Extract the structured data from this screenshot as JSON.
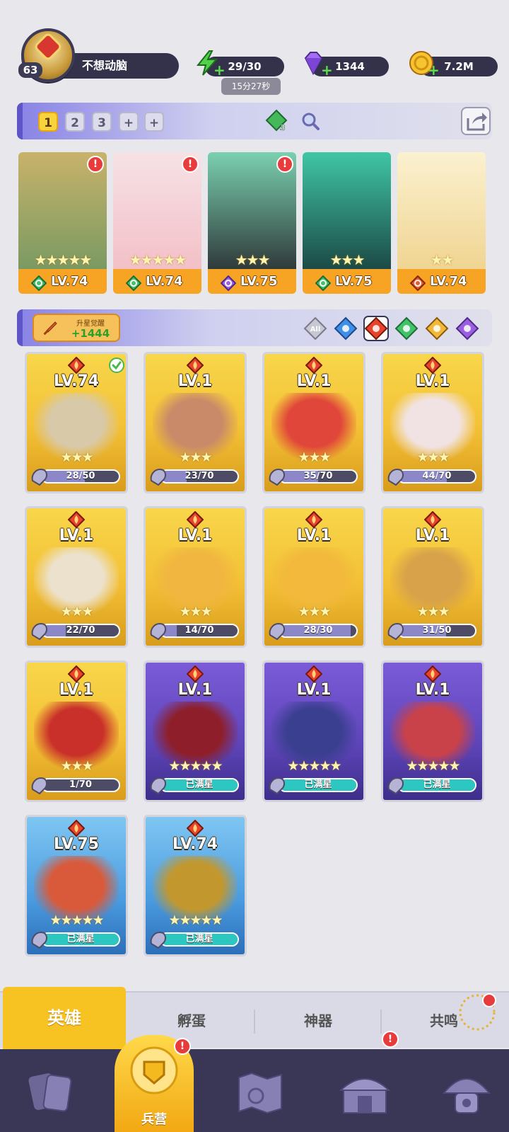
{
  "player": {
    "level": "63",
    "name": "不想动脑"
  },
  "resources": {
    "energy": {
      "value": "29/30",
      "icon": "lightning-icon",
      "timer": "15分27秒"
    },
    "gems": {
      "value": "1344",
      "icon": "diamond-icon"
    },
    "gold": {
      "value": "7.2M",
      "icon": "coin-icon"
    }
  },
  "team_tabs": [
    "1",
    "2",
    "3",
    "+",
    "+"
  ],
  "gem_count": "3",
  "team": [
    {
      "level": "LV.74",
      "stars": "★★★★★",
      "element": "wind",
      "alert": "!",
      "colors": [
        "#7a9a62",
        "#c8b26a"
      ]
    },
    {
      "level": "LV.74",
      "stars": "★★★★★",
      "element": "wind",
      "alert": "!",
      "colors": [
        "#f3c0c7",
        "#f6e2e6"
      ]
    },
    {
      "level": "LV.75",
      "stars": "★★★",
      "element": "dark",
      "alert": "!",
      "colors": [
        "#2f3a3a",
        "#7ad0b0"
      ]
    },
    {
      "level": "LV.75",
      "stars": "★★★",
      "element": "wind",
      "alert": "",
      "colors": [
        "#1c4a46",
        "#3fc6a4"
      ]
    },
    {
      "level": "LV.74",
      "stars": "★★",
      "element": "fire",
      "alert": "",
      "colors": [
        "#f0d592",
        "#fbf1d0"
      ]
    }
  ],
  "awaken": {
    "label": "升星觉醒",
    "value": "+1444"
  },
  "filters": [
    "All",
    "water",
    "fire",
    "wind",
    "light",
    "dark"
  ],
  "roster": [
    {
      "level": "LV.74",
      "stars": "★★★",
      "progress": "28/50",
      "ratio": 0.56,
      "tier": "gold",
      "checked": true,
      "art": "#d8c9a8"
    },
    {
      "level": "LV.1",
      "stars": "★★★",
      "progress": "23/70",
      "ratio": 0.33,
      "tier": "gold",
      "checked": false,
      "art": "#c98a6a"
    },
    {
      "level": "LV.1",
      "stars": "★★★",
      "progress": "35/70",
      "ratio": 0.5,
      "tier": "gold",
      "checked": false,
      "art": "#e0463a"
    },
    {
      "level": "LV.1",
      "stars": "★★★",
      "progress": "44/70",
      "ratio": 0.63,
      "tier": "gold",
      "checked": false,
      "art": "#f1e3e3"
    },
    {
      "level": "LV.1",
      "stars": "★★★",
      "progress": "22/70",
      "ratio": 0.31,
      "tier": "gold",
      "checked": false,
      "art": "#ece1cc"
    },
    {
      "level": "LV.1",
      "stars": "★★★",
      "progress": "14/70",
      "ratio": 0.2,
      "tier": "gold",
      "checked": false,
      "art": "#f0b640"
    },
    {
      "level": "LV.1",
      "stars": "★★★",
      "progress": "28/30",
      "ratio": 0.93,
      "tier": "gold",
      "checked": false,
      "art": "#f2b93c"
    },
    {
      "level": "LV.1",
      "stars": "★★★",
      "progress": "31/50",
      "ratio": 0.62,
      "tier": "gold",
      "checked": false,
      "art": "#d8a24a"
    },
    {
      "level": "LV.1",
      "stars": "★★★",
      "progress": "1/70",
      "ratio": 0.02,
      "tier": "gold",
      "checked": false,
      "art": "#c9302a"
    },
    {
      "level": "LV.1",
      "stars": "★★★★★",
      "progress": "已满星",
      "ratio": 1,
      "tier": "purple",
      "checked": false,
      "art": "#8e1f2a"
    },
    {
      "level": "LV.1",
      "stars": "★★★★★",
      "progress": "已满星",
      "ratio": 1,
      "tier": "purple",
      "checked": false,
      "art": "#3a3f8f"
    },
    {
      "level": "LV.1",
      "stars": "★★★★★",
      "progress": "已满星",
      "ratio": 1,
      "tier": "purple",
      "checked": false,
      "art": "#c9424a"
    },
    {
      "level": "LV.75",
      "stars": "★★★★★",
      "progress": "已满星",
      "ratio": 1,
      "tier": "blue",
      "checked": false,
      "art": "#d95a3a"
    },
    {
      "level": "LV.74",
      "stars": "★★★★★",
      "progress": "已满星",
      "ratio": 1,
      "tier": "blue",
      "checked": false,
      "art": "#c2982e"
    }
  ],
  "subtabs": [
    "英雄",
    "孵蛋",
    "神器",
    "共鸣"
  ],
  "nav": [
    {
      "name": "cards",
      "label": ""
    },
    {
      "name": "barracks",
      "label": "兵营",
      "alert": "!"
    },
    {
      "name": "map",
      "label": ""
    },
    {
      "name": "temple",
      "label": "",
      "alert": "!"
    },
    {
      "name": "guild",
      "label": ""
    }
  ],
  "colors": {
    "accent": "#f7c323",
    "alert": "#e83b3b",
    "panel": "#34314a"
  }
}
